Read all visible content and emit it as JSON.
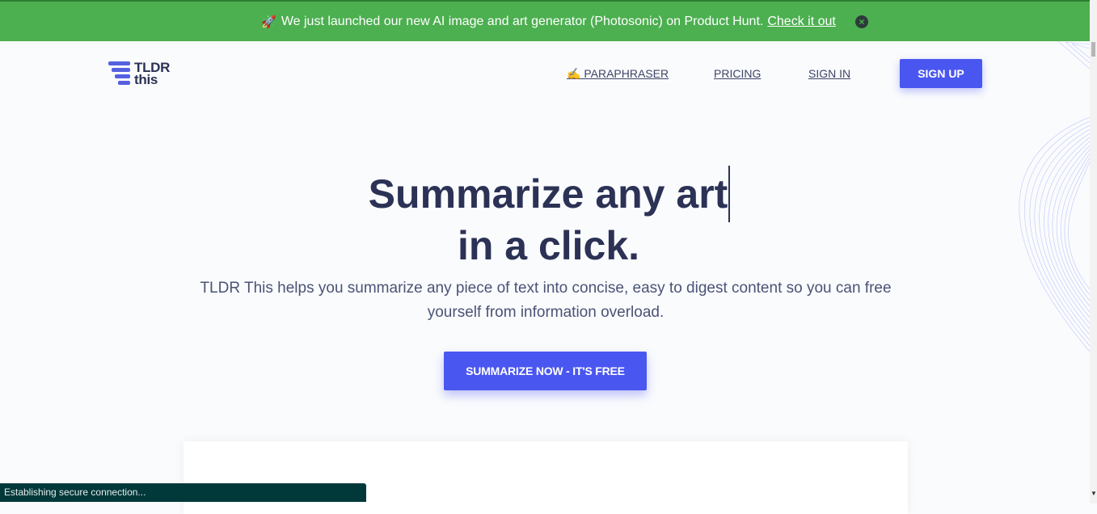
{
  "banner": {
    "rocket_icon": "rocket-icon",
    "text": "We just launched our new AI image and art generator (Photosonic) on Product Hunt.",
    "link": "Check it out",
    "close_icon": "close-circle-icon",
    "color": "#4caf50"
  },
  "logo": {
    "line1": "TLDR",
    "line2": "this"
  },
  "nav": {
    "paraphraser": "✍️ PARAPHRASER",
    "pricing": "PRICING",
    "signin": "SIGN IN",
    "signup": "SIGN UP"
  },
  "hero": {
    "title_line1": "Summarize any art",
    "title_line2": "in a click.",
    "subtitle": "TLDR This helps you summarize any piece of text into concise, easy to digest content so you can free yourself from information overload.",
    "cta": "SUMMARIZE NOW - IT'S FREE"
  },
  "status": {
    "text": "Establishing secure connection..."
  },
  "colors": {
    "accent": "#4a56f0",
    "heading": "#2b3255",
    "status_bg": "#01383a"
  }
}
